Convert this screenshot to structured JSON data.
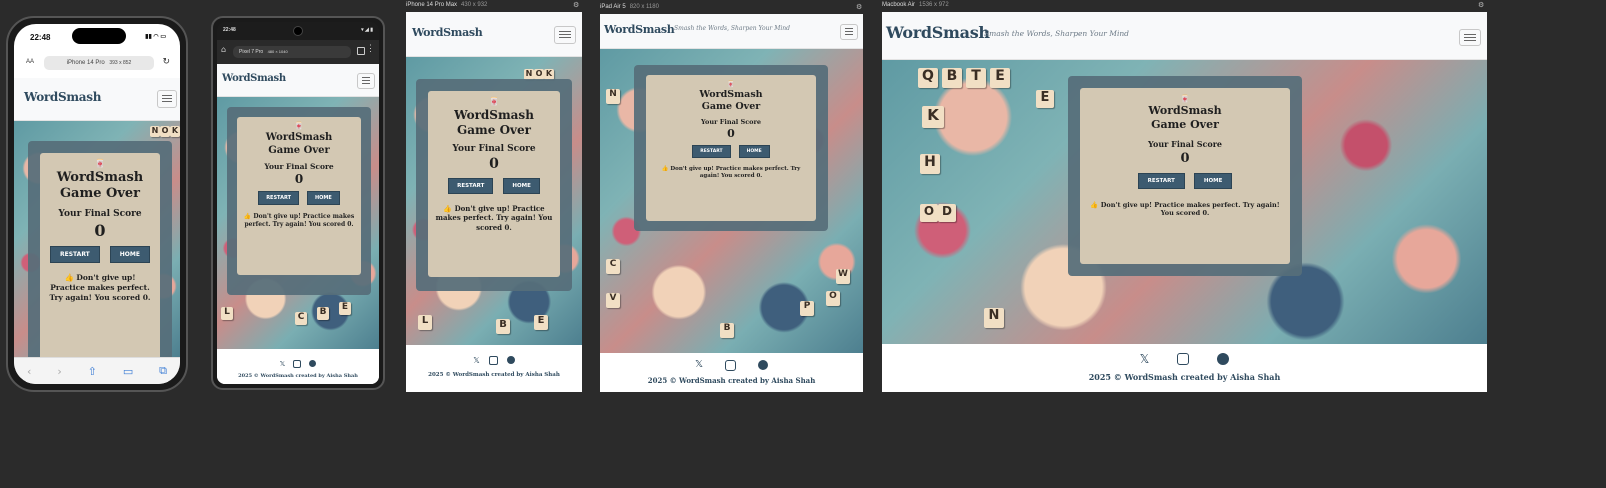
{
  "site": {
    "logo": "WordSmash",
    "tagline": "Smash the Words, Sharpen Your Mind",
    "emoji": "🀄",
    "title_line1": "WordSmash",
    "title_line2": "Game Over",
    "score_label": "Your Final Score",
    "score_value": "0",
    "restart_label": "RESTART",
    "home_label": "HOME",
    "message_icon": "👍",
    "message": "Don't give up! Practice makes perfect. Try again! You scored 0.",
    "footer_copy": "2025 © WordSmash created by Aisha Shah",
    "footer_icons": [
      "x-icon",
      "instagram-icon",
      "facebook-icon"
    ],
    "colors": {
      "brand": "#2f4a5e",
      "card_bg": "#d3c8b3",
      "button": "#3d5b70",
      "page_bg": "#2b2b2b"
    }
  },
  "tiles": [
    "N",
    "O",
    "K",
    "Q",
    "B",
    "T",
    "E",
    "K",
    "H",
    "O",
    "D",
    "L",
    "B",
    "E",
    "C",
    "N",
    "C",
    "V",
    "W",
    "O",
    "P"
  ],
  "devices": {
    "iphone14": {
      "label": "iPhone 14 Pro",
      "dims": "393 x 852",
      "time": "22:48",
      "font_size_control": "AA",
      "reload_glyph": "↻",
      "bottom_glyphs": [
        "‹",
        "›",
        "⇧",
        "▭",
        "⧉"
      ]
    },
    "pixel7": {
      "label": "Pixel 7 Pro",
      "dims": "480 × 1040",
      "time": "22:48",
      "status_glyph": "▾ ◢ ▮",
      "home_glyph": "⌂",
      "menu_glyph": "⋮"
    },
    "iphone14promax": {
      "label": "iPhone 14 Pro Max",
      "dims": "430 x 932"
    },
    "ipadair": {
      "label": "iPad Air 5",
      "dims": "820 x 1180"
    },
    "macbookair": {
      "label": "Macbook Air",
      "dims": "1536 x 972"
    }
  }
}
